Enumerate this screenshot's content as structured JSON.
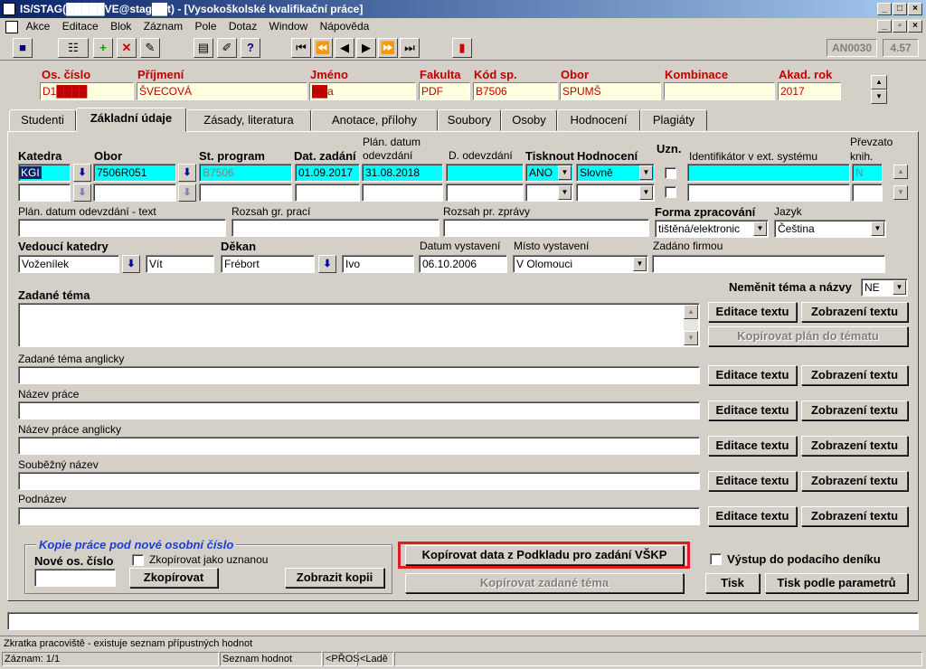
{
  "window": {
    "title": "IS/STAG(█████VE@stag██t) - [Vysokoškolské kvalifikační práce]"
  },
  "menu": [
    "Akce",
    "Editace",
    "Blok",
    "Záznam",
    "Pole",
    "Dotaz",
    "Window",
    "Nápověda"
  ],
  "toolbar": {
    "screen_code": "AN0030",
    "version": "4.57"
  },
  "header": {
    "labels": [
      "Os. číslo",
      "Příjmení",
      "Jméno",
      "Fakulta",
      "Kód sp.",
      "Obor",
      "Kombinace",
      "Akad. rok"
    ],
    "values": [
      "D1████",
      "ŠVECOVÁ",
      "██a",
      "PDF",
      "B7506",
      "SPUMŠ",
      "",
      "2017"
    ]
  },
  "tabs": [
    "Studenti",
    "Základní údaje",
    "Zásady, literatura",
    "Anotace, přílohy",
    "Soubory",
    "Osoby",
    "Hodnocení",
    "Plagiáty"
  ],
  "grid": {
    "labels": {
      "katedra": "Katedra",
      "obor": "Obor",
      "st_program": "St. program",
      "dat_zadani": "Dat. zadání",
      "plan_datum_1": "Plán. datum",
      "plan_datum_2": "odevzdání",
      "d_odevzdani": "D. odevzdání",
      "tisknout": "Tisknout",
      "hodnoceni": "Hodnocení",
      "uzn": "Uzn.",
      "identifikator": "Identifikátor v ext. systému",
      "prevzato_1": "Převzato",
      "prevzato_2": "knih."
    },
    "row1": {
      "katedra": "KGI",
      "obor": "7506R051",
      "st_program": "B7506",
      "dat_zadani": "01.09.2017",
      "plan_datum": "31.08.2018",
      "d_odevzdani": "",
      "tisknout": "ANO",
      "hodnoceni": "Slovně",
      "identifikator": "",
      "prevzato": "N"
    }
  },
  "form": {
    "plan_datum_text_label": "Plán. datum odevzdání - text",
    "rozsah_gr_label": "Rozsah gr. prací",
    "rozsah_pr_label": "Rozsah pr. zprávy",
    "forma_label": "Forma zpracování",
    "forma_value": "tištěná/elektronic",
    "jazyk_label": "Jazyk",
    "jazyk_value": "Čeština",
    "vedouci_label": "Vedoucí katedry",
    "vedouci_prijmeni": "Voženílek",
    "vedouci_jmeno": "Vít",
    "dekan_label": "Děkan",
    "dekan_prijmeni": "Frébort",
    "dekan_jmeno": "Ivo",
    "datum_vystaveni_label": "Datum vystavení",
    "datum_vystaveni": "06.10.2006",
    "misto_label": "Místo vystavení",
    "misto_value": "V Olomouci",
    "zadano_firmou_label": "Zadáno firmou",
    "nemenit_label": "Neměnit téma a názvy",
    "nemenit_value": "NE",
    "zadane_tema_label": "Zadané téma",
    "zadane_tema_en_label": "Zadané téma anglicky",
    "nazev_label": "Název práce",
    "nazev_en_label": "Název práce anglicky",
    "soubezny_label": "Souběžný název",
    "podnazev_label": "Podnázev",
    "editace_label": "Editace textu",
    "zobrazeni_label": "Zobrazení textu",
    "kopirovat_plan_label": "Kopírovat plán do tématu"
  },
  "kopie": {
    "title": "Kopie práce pod nové osobní číslo",
    "nove_label": "Nové os. číslo",
    "uznany_label": "Zkopírovat jako uznanou",
    "zkopirovat_label": "Zkopírovat",
    "zobrazit_label": "Zobrazit kopii"
  },
  "actions": {
    "kopirovat_podklad": "Kopírovat data z Podkladu pro zadání VŠKP",
    "kopirovat_zadane": "Kopírovat zadané téma",
    "vystup_label": "Výstup do podacího deníku",
    "tisk": "Tisk",
    "tisk_param": "Tisk podle parametrů"
  },
  "status": {
    "hint": "Zkratka pracoviště - existuje seznam přípustných hodnot",
    "zaznam": "Záznam: 1/1",
    "seznam": "Seznam hodnot",
    "pros": "<PŘOS",
    "lade": "<Ladě"
  },
  "colors": {
    "highlight": "#e01b24",
    "field_cyan": "#00ffff",
    "label_red": "#c00000"
  }
}
